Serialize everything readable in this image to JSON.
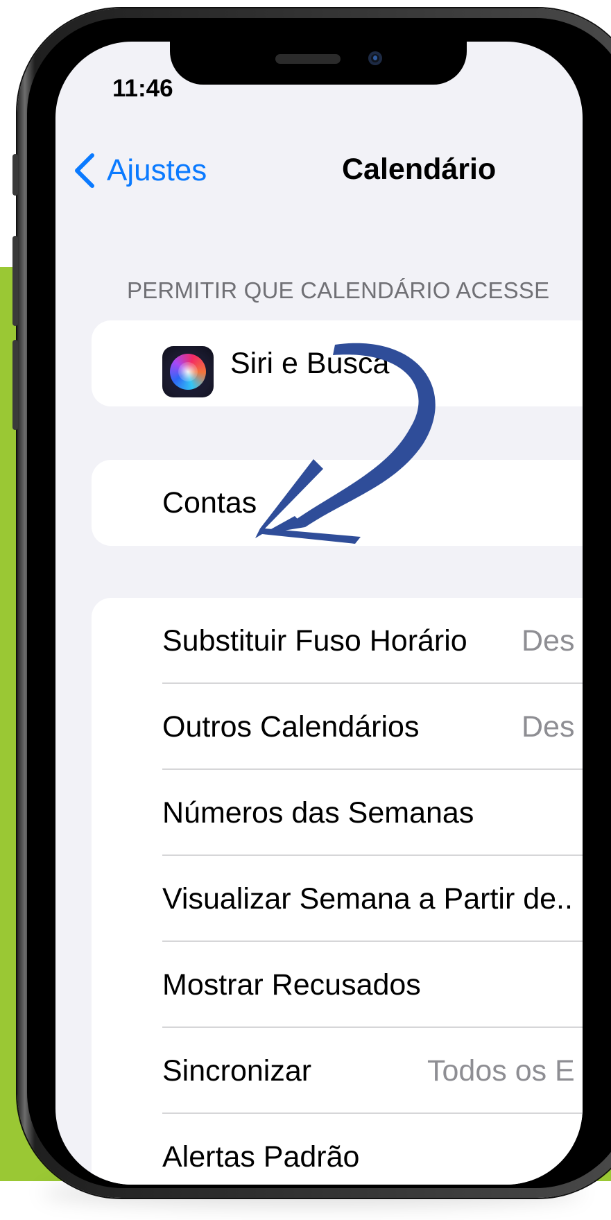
{
  "status_bar": {
    "time": "11:46"
  },
  "nav": {
    "back_label": "Ajustes",
    "title": "Calendário"
  },
  "section": {
    "header": "PERMITIR QUE CALENDÁRIO ACESSE"
  },
  "access_group": {
    "siri_label": "Siri e Busca"
  },
  "accounts_group": {
    "label": "Contas"
  },
  "settings": [
    {
      "label": "Substituir Fuso Horário",
      "value": "Des"
    },
    {
      "label": "Outros Calendários",
      "value": "Des"
    },
    {
      "label": "Números das Semanas",
      "value": ""
    },
    {
      "label": "Visualizar Semana a Partir de..",
      "value": ""
    },
    {
      "label": "Mostrar Recusados",
      "value": ""
    },
    {
      "label": "Sincronizar",
      "value": "Todos os E"
    },
    {
      "label": "Alertas Padrão",
      "value": ""
    }
  ],
  "colors": {
    "background_green": "#9ac834",
    "accent_blue": "#0a7aff",
    "annotation_arrow": "#2f4d99"
  },
  "icons": {
    "back": "chevron-left-icon",
    "siri": "siri-icon",
    "annotation": "curved-arrow-icon"
  }
}
